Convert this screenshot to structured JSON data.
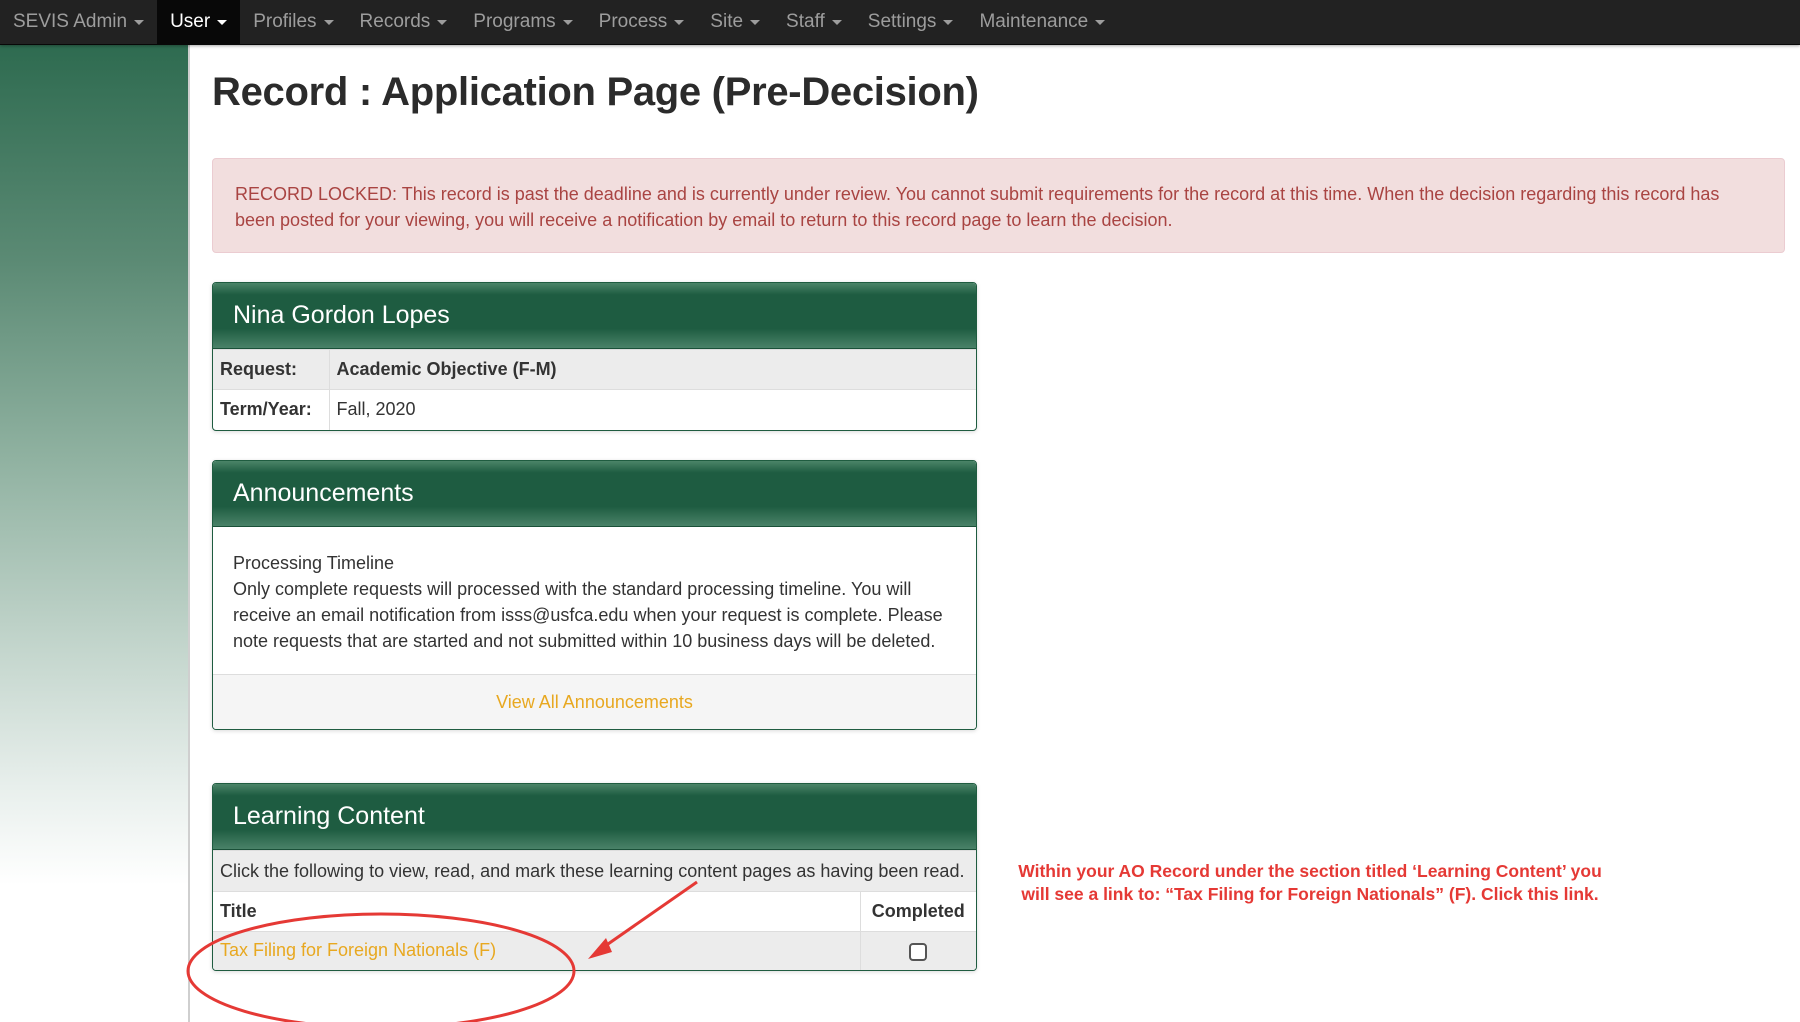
{
  "navbar": {
    "items": [
      {
        "label": "SEVIS Admin",
        "active": false
      },
      {
        "label": "User",
        "active": true
      },
      {
        "label": "Profiles",
        "active": false
      },
      {
        "label": "Records",
        "active": false
      },
      {
        "label": "Programs",
        "active": false
      },
      {
        "label": "Process",
        "active": false
      },
      {
        "label": "Site",
        "active": false
      },
      {
        "label": "Staff",
        "active": false
      },
      {
        "label": "Settings",
        "active": false
      },
      {
        "label": "Maintenance",
        "active": false
      }
    ]
  },
  "page": {
    "title": "Record : Application Page (Pre-Decision)"
  },
  "alert": {
    "text": "RECORD LOCKED: This record is past the deadline and is currently under review. You cannot submit requirements for the record at this time. When the decision regarding this record has been posted for your viewing, you will receive a notification by email to return to this record page to learn the decision."
  },
  "record_panel": {
    "name": "Nina Gordon Lopes",
    "rows": [
      {
        "label": "Request:",
        "value": "Academic Objective (F-M)",
        "bold_value": true
      },
      {
        "label": "Term/Year:",
        "value": "Fall, 2020",
        "bold_value": false
      }
    ]
  },
  "announcements_panel": {
    "title": "Announcements",
    "heading": "Processing Timeline",
    "body": "Only complete requests will processed with the standard processing timeline. You will receive an email notification from isss@usfca.edu when your request is complete. Please note requests that are started and not submitted within 10 business days will be deleted.",
    "footer_link": "View All Announcements"
  },
  "learning_panel": {
    "title": "Learning Content",
    "intro": "Click the following to view, read, and mark these learning content pages as having been read.",
    "columns": [
      "Title",
      "Completed"
    ],
    "rows": [
      {
        "title": "Tax Filing for Foreign Nationals (F)",
        "completed": false
      }
    ]
  },
  "annotation": {
    "line1": "Within your AO Record under the section titled ‘Learning Content’ you",
    "line2": "will see a link to: “Tax Filing for Foreign Nationals” (F). Click this link.",
    "color": "#e53935"
  },
  "colors": {
    "navbar_bg": "#222222",
    "panel_header": "#1e5c41",
    "alert_bg": "#f2dede",
    "alert_text": "#a94442",
    "link": "#e8a820"
  }
}
